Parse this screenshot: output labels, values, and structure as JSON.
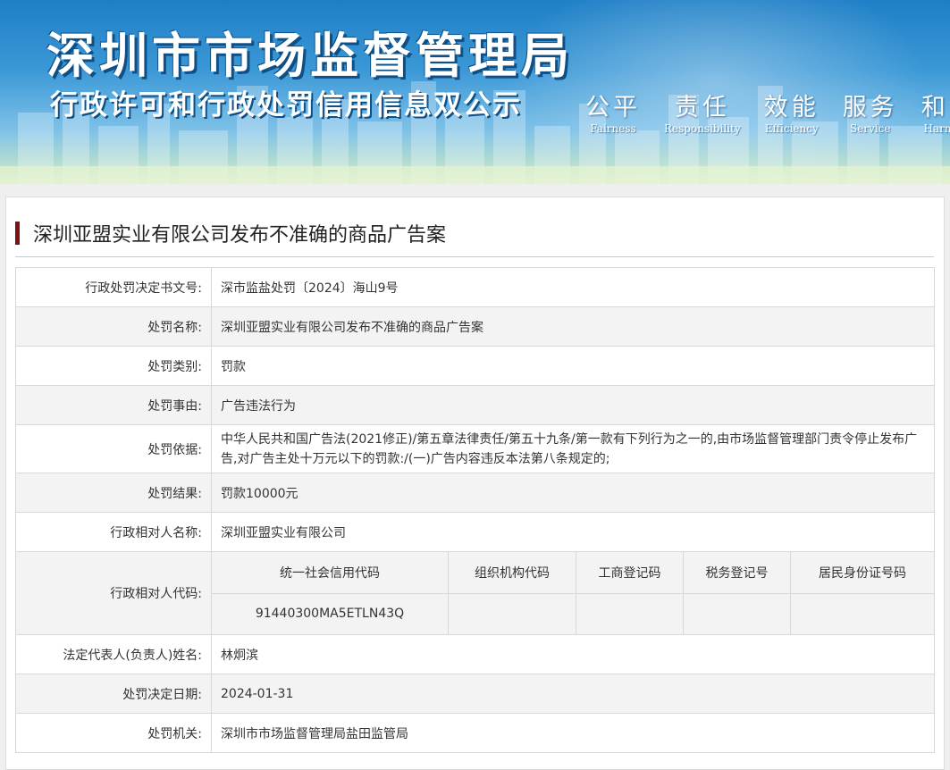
{
  "banner": {
    "org_title": "深圳市市场监督管理局",
    "subtitle": "行政许可和行政处罚信用信息双公示",
    "slogans": [
      {
        "zh": "公平",
        "en": "Fairness"
      },
      {
        "zh": "责任",
        "en": "Responsibility"
      },
      {
        "zh": "效能",
        "en": "Efficiency"
      },
      {
        "zh": "服务",
        "en": "Service"
      },
      {
        "zh": "和谐",
        "en": "Harmony"
      }
    ]
  },
  "case": {
    "title": "深圳亚盟实业有限公司发布不准确的商品广告案",
    "rows": [
      {
        "label": "行政处罚决定书文号:",
        "value": "深市监盐处罚〔2024〕海山9号"
      },
      {
        "label": "处罚名称:",
        "value": "深圳亚盟实业有限公司发布不准确的商品广告案"
      },
      {
        "label": "处罚类别:",
        "value": "罚款"
      },
      {
        "label": "处罚事由:",
        "value": "广告违法行为"
      },
      {
        "label": "处罚依据:",
        "value": "中华人民共和国广告法(2021修正)/第五章法律责任/第五十九条/第一款有下列行为之一的,由市场监督管理部门责令停止发布广告,对广告主处十万元以下的罚款:/(一)广告内容违反本法第八条规定的;"
      },
      {
        "label": "处罚结果:",
        "value": "罚款10000元"
      },
      {
        "label": "行政相对人名称:",
        "value": "深圳亚盟实业有限公司"
      }
    ],
    "code_row": {
      "label": "行政相对人代码:",
      "headers": [
        "统一社会信用代码",
        "组织机构代码",
        "工商登记码",
        "税务登记号",
        "居民身份证号码"
      ],
      "values": [
        "91440300MA5ETLN43Q",
        "",
        "",
        "",
        ""
      ]
    },
    "rows2": [
      {
        "label": "法定代表人(负责人)姓名:",
        "value": "林炯滨"
      },
      {
        "label": "处罚决定日期:",
        "value": "2024-01-31"
      },
      {
        "label": "处罚机关:",
        "value": "深圳市市场监督管理局盐田监管局"
      }
    ]
  },
  "colors": {
    "title_bar": "#7a1212",
    "banner_top": "#1e7fc6",
    "row_alt": "#f3f3f3"
  }
}
